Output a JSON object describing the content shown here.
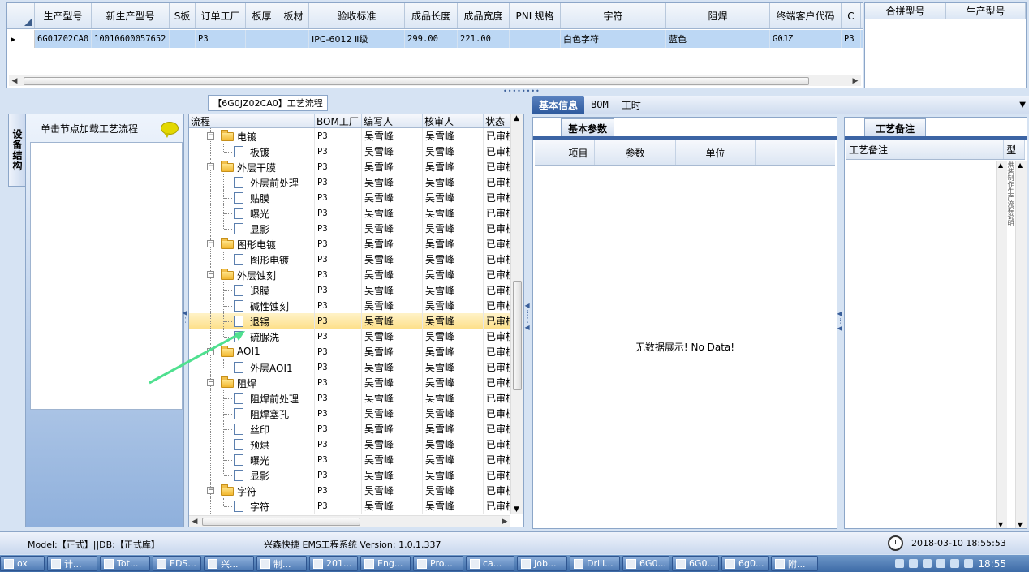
{
  "top_grid": {
    "columns": [
      "生产型号",
      "新生产型号",
      "S板",
      "订单工厂",
      "板厚",
      "板材",
      "验收标准",
      "成品长度",
      "成品宽度",
      "PNL规格",
      "字符",
      "阻焊",
      "终端客户代码",
      "C"
    ],
    "row": [
      "6G0JZ02CA0",
      "10010600057652",
      "",
      "P3",
      "",
      "",
      "IPC-6012 Ⅱ级",
      "299.00",
      "221.00",
      "",
      "白色字符",
      "蓝色",
      "G0JZ",
      "P3"
    ],
    "row_indicator": "▶"
  },
  "merge_grid": {
    "columns": [
      "合拼型号",
      "生产型号"
    ]
  },
  "left_panel": {
    "vertical_tab": "设备结构",
    "hint": "单击节点加载工艺流程"
  },
  "process": {
    "tab_title": "【6G0JZ02CA0】工艺流程",
    "columns": [
      "流程",
      "BOM工厂",
      "编写人",
      "核审人",
      "状态"
    ],
    "rows": [
      {
        "name": "电镀",
        "type": "folder",
        "factory": "P3",
        "writer": "吴雪峰",
        "reviewer": "吴雪峰",
        "status": "已审核"
      },
      {
        "name": "板镀",
        "type": "doc",
        "factory": "P3",
        "writer": "吴雪峰",
        "reviewer": "吴雪峰",
        "status": "已审核"
      },
      {
        "name": "外层干膜",
        "type": "folder",
        "factory": "P3",
        "writer": "吴雪峰",
        "reviewer": "吴雪峰",
        "status": "已审核"
      },
      {
        "name": "外层前处理",
        "type": "doc",
        "factory": "P3",
        "writer": "吴雪峰",
        "reviewer": "吴雪峰",
        "status": "已审核"
      },
      {
        "name": "贴膜",
        "type": "doc",
        "factory": "P3",
        "writer": "吴雪峰",
        "reviewer": "吴雪峰",
        "status": "已审核"
      },
      {
        "name": "曝光",
        "type": "doc",
        "factory": "P3",
        "writer": "吴雪峰",
        "reviewer": "吴雪峰",
        "status": "已审核"
      },
      {
        "name": "显影",
        "type": "doc",
        "factory": "P3",
        "writer": "吴雪峰",
        "reviewer": "吴雪峰",
        "status": "已审核"
      },
      {
        "name": "图形电镀",
        "type": "folder",
        "factory": "P3",
        "writer": "吴雪峰",
        "reviewer": "吴雪峰",
        "status": "已审核"
      },
      {
        "name": "图形电镀",
        "type": "doc",
        "factory": "P3",
        "writer": "吴雪峰",
        "reviewer": "吴雪峰",
        "status": "已审核"
      },
      {
        "name": "外层蚀刻",
        "type": "folder",
        "factory": "P3",
        "writer": "吴雪峰",
        "reviewer": "吴雪峰",
        "status": "已审核"
      },
      {
        "name": "退膜",
        "type": "doc",
        "factory": "P3",
        "writer": "吴雪峰",
        "reviewer": "吴雪峰",
        "status": "已审核"
      },
      {
        "name": "碱性蚀刻",
        "type": "doc",
        "factory": "P3",
        "writer": "吴雪峰",
        "reviewer": "吴雪峰",
        "status": "已审核"
      },
      {
        "name": "退锡",
        "type": "doc",
        "factory": "P3",
        "writer": "吴雪峰",
        "reviewer": "吴雪峰",
        "status": "已审核",
        "selected": true
      },
      {
        "name": "硫脲洗",
        "type": "doc",
        "factory": "P3",
        "writer": "吴雪峰",
        "reviewer": "吴雪峰",
        "status": "已审核"
      },
      {
        "name": "AOI1",
        "type": "folder",
        "factory": "P3",
        "writer": "吴雪峰",
        "reviewer": "吴雪峰",
        "status": "已审核"
      },
      {
        "name": "外层AOI1",
        "type": "doc",
        "factory": "P3",
        "writer": "吴雪峰",
        "reviewer": "吴雪峰",
        "status": "已审核"
      },
      {
        "name": "阻焊",
        "type": "folder",
        "factory": "P3",
        "writer": "吴雪峰",
        "reviewer": "吴雪峰",
        "status": "已审核"
      },
      {
        "name": "阻焊前处理",
        "type": "doc",
        "factory": "P3",
        "writer": "吴雪峰",
        "reviewer": "吴雪峰",
        "status": "已审核"
      },
      {
        "name": "阻焊塞孔",
        "type": "doc",
        "factory": "P3",
        "writer": "吴雪峰",
        "reviewer": "吴雪峰",
        "status": "已审核"
      },
      {
        "name": "丝印",
        "type": "doc",
        "factory": "P3",
        "writer": "吴雪峰",
        "reviewer": "吴雪峰",
        "status": "已审核"
      },
      {
        "name": "预烘",
        "type": "doc",
        "factory": "P3",
        "writer": "吴雪峰",
        "reviewer": "吴雪峰",
        "status": "已审核"
      },
      {
        "name": "曝光",
        "type": "doc",
        "factory": "P3",
        "writer": "吴雪峰",
        "reviewer": "吴雪峰",
        "status": "已审核"
      },
      {
        "name": "显影",
        "type": "doc",
        "factory": "P3",
        "writer": "吴雪峰",
        "reviewer": "吴雪峰",
        "status": "已审核"
      },
      {
        "name": "字符",
        "type": "folder",
        "factory": "P3",
        "writer": "吴雪峰",
        "reviewer": "吴雪峰",
        "status": "已审核"
      },
      {
        "name": "字符",
        "type": "doc",
        "factory": "P3",
        "writer": "吴雪峰",
        "reviewer": "吴雪峰",
        "status": "已审核"
      }
    ]
  },
  "detail": {
    "tabs": [
      "基本信息",
      "BOM",
      "工时"
    ],
    "basic_params": {
      "section_title": "基本参数",
      "columns": [
        "项目",
        "参数",
        "单位"
      ],
      "empty_text": "无数据展示! No Data!"
    },
    "craft_notes": {
      "section_title": "工艺备注",
      "columns": [
        "工艺备注",
        "型"
      ],
      "vertical_text": "烘烤制作生产流程说明"
    }
  },
  "status_bar": {
    "left": "Model:【正式】||DB:【正式库】",
    "center": "兴森快捷 EMS工程系统 Version: 1.0.1.337",
    "datetime": "2018-03-10 18:55:53"
  },
  "taskbar": {
    "items": [
      "ox",
      "计...",
      "Tot...",
      "EDS...",
      "兴...",
      "制...",
      "201...",
      "Eng...",
      "Pro...",
      "ca...",
      "Job...",
      "Drill...",
      "6G0...",
      "6G0...",
      "6g0...",
      "附..."
    ],
    "time": "18:55"
  },
  "colors": {
    "selection_row": "#bcd7f4",
    "selected_tree_row": "#fde08a",
    "active_tab": "#2e5a9e",
    "annotation_arrow": "#4fe08f"
  }
}
